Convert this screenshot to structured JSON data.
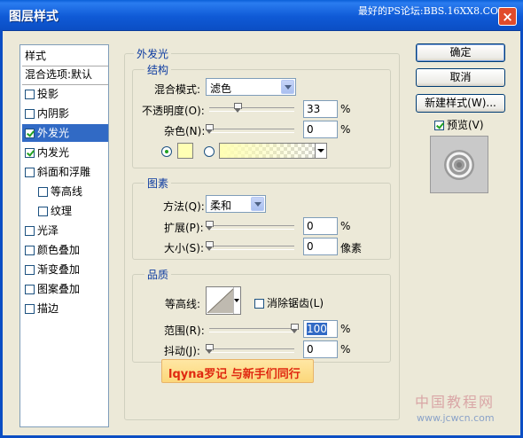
{
  "window": {
    "title": "图层样式",
    "watermark": "最好的PS论坛:BBS.16XX8.COM",
    "close_glyph": "×"
  },
  "sidebar": {
    "items": [
      {
        "label": "样式",
        "checkbox": false,
        "checked": false,
        "indent": false,
        "selected": false
      },
      {
        "label": "混合选项:默认",
        "checkbox": false,
        "checked": false,
        "indent": false,
        "selected": false
      },
      {
        "label": "投影",
        "checkbox": true,
        "checked": false,
        "indent": false,
        "selected": false
      },
      {
        "label": "内阴影",
        "checkbox": true,
        "checked": false,
        "indent": false,
        "selected": false
      },
      {
        "label": "外发光",
        "checkbox": true,
        "checked": true,
        "indent": false,
        "selected": true
      },
      {
        "label": "内发光",
        "checkbox": true,
        "checked": true,
        "indent": false,
        "selected": false
      },
      {
        "label": "斜面和浮雕",
        "checkbox": true,
        "checked": false,
        "indent": false,
        "selected": false
      },
      {
        "label": "等高线",
        "checkbox": true,
        "checked": false,
        "indent": true,
        "selected": false
      },
      {
        "label": "纹理",
        "checkbox": true,
        "checked": false,
        "indent": true,
        "selected": false
      },
      {
        "label": "光泽",
        "checkbox": true,
        "checked": false,
        "indent": false,
        "selected": false
      },
      {
        "label": "颜色叠加",
        "checkbox": true,
        "checked": false,
        "indent": false,
        "selected": false
      },
      {
        "label": "渐变叠加",
        "checkbox": true,
        "checked": false,
        "indent": false,
        "selected": false
      },
      {
        "label": "图案叠加",
        "checkbox": true,
        "checked": false,
        "indent": false,
        "selected": false
      },
      {
        "label": "描边",
        "checkbox": true,
        "checked": false,
        "indent": false,
        "selected": false
      }
    ]
  },
  "outer_glow": {
    "title": "外发光",
    "structure": {
      "title": "结构",
      "blend_mode_label": "混合模式:",
      "blend_mode_value": "滤色",
      "opacity_label": "不透明度(O):",
      "opacity_value": "33",
      "opacity_unit": "%",
      "opacity_slider": 0.33,
      "noise_label": "杂色(N):",
      "noise_value": "0",
      "noise_unit": "%",
      "noise_slider": 0,
      "color_swatch": "#ffffb4",
      "gradient_selected": false
    },
    "elements": {
      "title": "图素",
      "technique_label": "方法(Q):",
      "technique_value": "柔和",
      "spread_label": "扩展(P):",
      "spread_value": "0",
      "spread_unit": "%",
      "spread_slider": 0,
      "size_label": "大小(S):",
      "size_value": "0",
      "size_unit": "像素",
      "size_slider": 0
    },
    "quality": {
      "title": "品质",
      "contour_label": "等高线:",
      "anti_alias_label": "消除锯齿(L)",
      "anti_alias_checked": false,
      "range_label": "范围(R):",
      "range_value": "100",
      "range_unit": "%",
      "range_slider": 1.0,
      "jitter_label": "抖动(J):",
      "jitter_value": "0",
      "jitter_unit": "%",
      "jitter_slider": 0
    }
  },
  "buttons": {
    "ok": "确定",
    "cancel": "取消",
    "new_style": "新建样式(W)...",
    "preview_label": "预览(V)",
    "preview_checked": true
  },
  "overlay_caption": "lqyna罗记 与新手们同行",
  "corner_watermark": {
    "title": "中国教程网",
    "url": "www.jcwcn.com"
  }
}
